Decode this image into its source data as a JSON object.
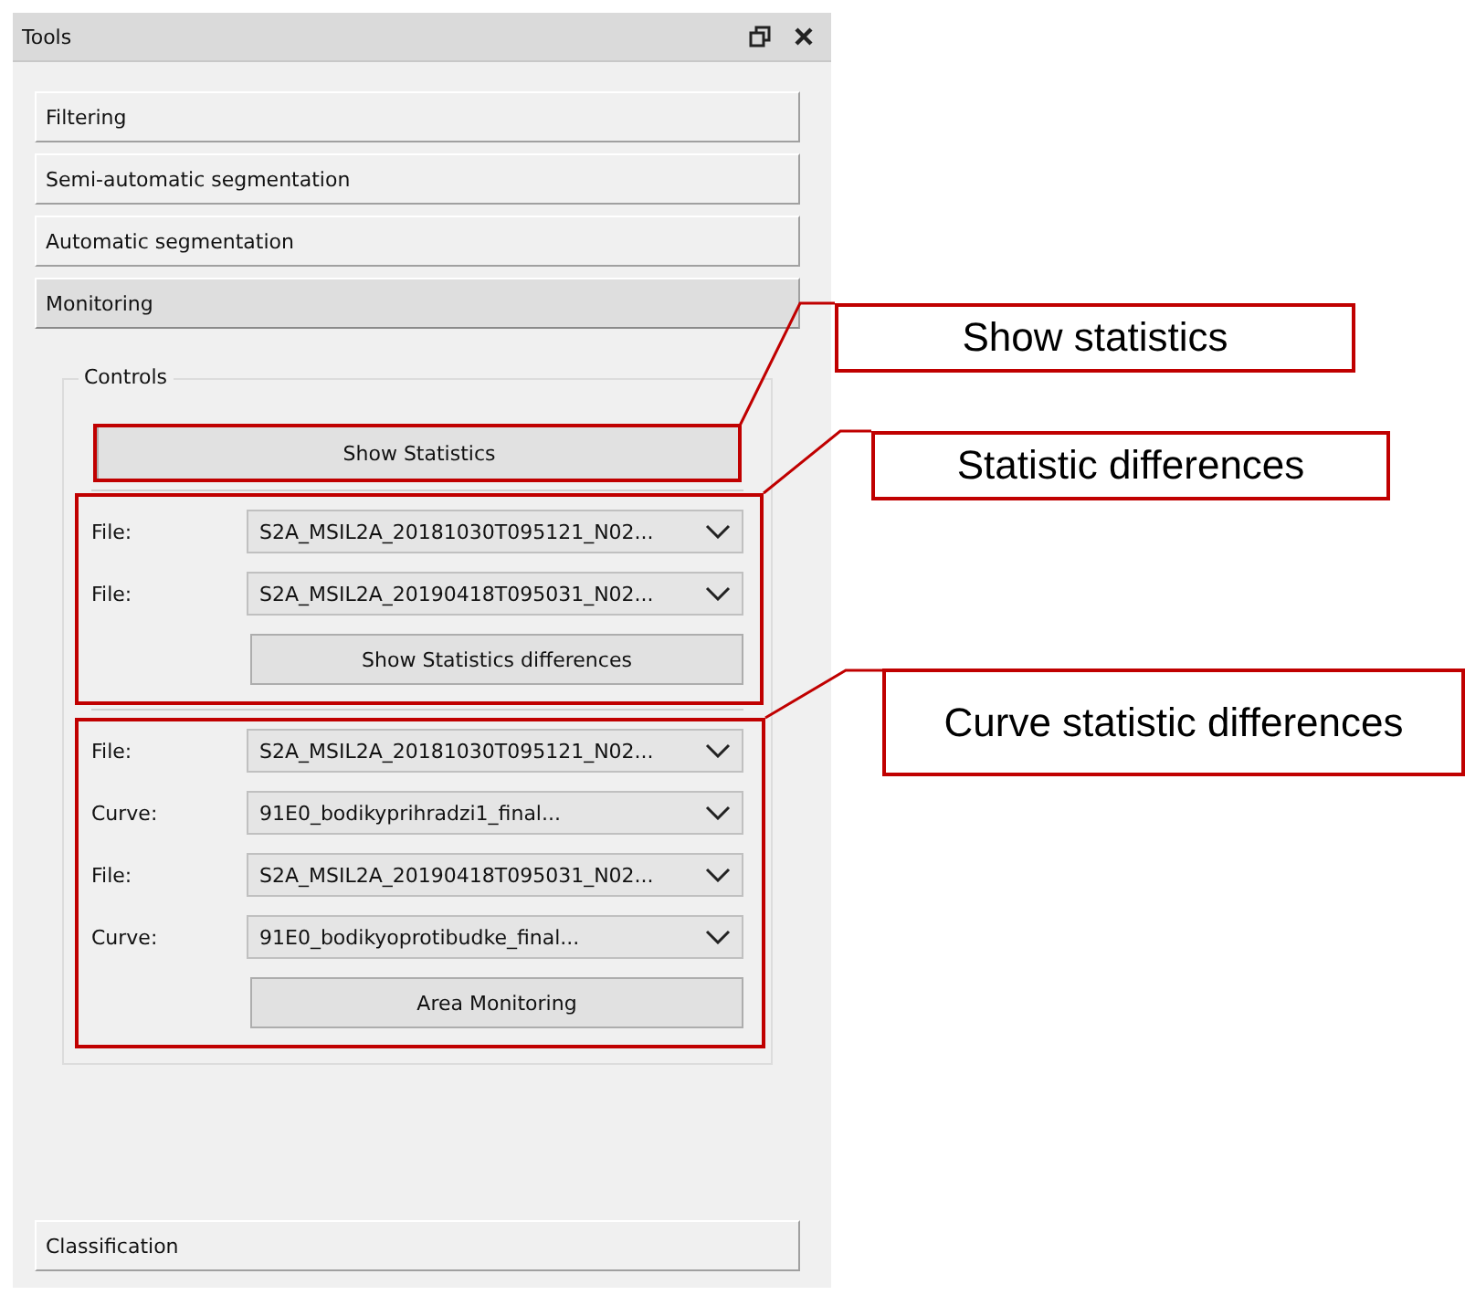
{
  "window": {
    "title": "Tools"
  },
  "sections": [
    {
      "label": "Filtering",
      "expanded": false
    },
    {
      "label": "Semi-automatic segmentation",
      "expanded": false
    },
    {
      "label": "Automatic segmentation",
      "expanded": false
    },
    {
      "label": "Monitoring",
      "expanded": true
    },
    {
      "label": "Classification",
      "expanded": false
    }
  ],
  "controls": {
    "title": "Controls",
    "button": "Show Statistics",
    "groups": [
      {
        "rows": [
          {
            "label": "File:",
            "value": "S2A_MSIL2A_20181030T095121_N02..."
          },
          {
            "label": "File:",
            "value": "S2A_MSIL2A_20190418T095031_N02..."
          }
        ],
        "button": "Show Statistics differences"
      },
      {
        "rows": [
          {
            "label": "File:",
            "value": "S2A_MSIL2A_20181030T095121_N02..."
          },
          {
            "label": "Curve:",
            "value": "91E0_bodikyprihradzi1_final..."
          },
          {
            "label": "File:",
            "value": "S2A_MSIL2A_20190418T095031_N02..."
          },
          {
            "label": "Curve:",
            "value": "91E0_bodikyoprotibudke_final..."
          }
        ],
        "button": "Area Monitoring"
      }
    ]
  },
  "callouts": [
    {
      "text": "Show statistics"
    },
    {
      "text": "Statistic differences"
    },
    {
      "text": "Curve statistic differences"
    }
  ]
}
